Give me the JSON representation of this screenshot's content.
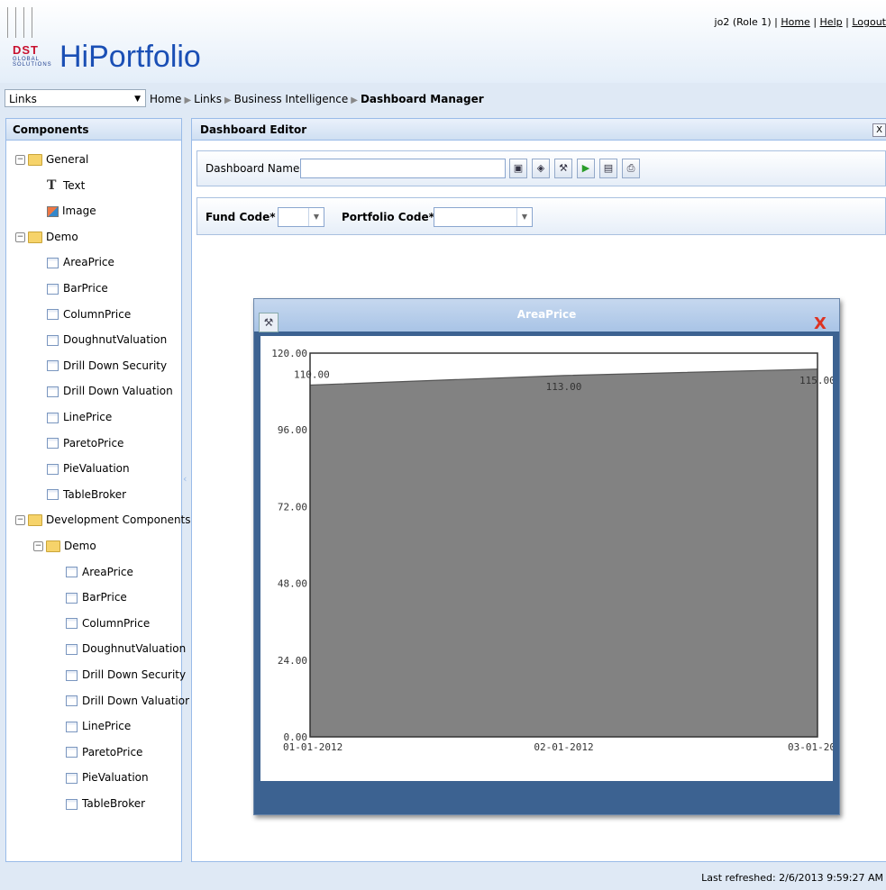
{
  "header": {
    "logo_text": "DST",
    "logo_subtext": "GLOBAL SOLUTIONS",
    "brand": "HiPortfolio",
    "user": "jo2 (Role 1)",
    "home_link": "Home",
    "help_link": "Help",
    "logout_link": "Logout",
    "sep": "|"
  },
  "nav": {
    "links_select_value": "Links",
    "breadcrumb": [
      "Home",
      "Links",
      "Business Intelligence",
      "Dashboard Manager"
    ]
  },
  "components": {
    "title": "Components",
    "general": {
      "label": "General",
      "items": [
        "Text",
        "Image"
      ]
    },
    "demo": {
      "label": "Demo",
      "items": [
        "AreaPrice",
        "BarPrice",
        "ColumnPrice",
        "DoughnutValuation",
        "Drill Down Security",
        "Drill Down Valuation",
        "LinePrice",
        "ParetoPrice",
        "PieValuation",
        "TableBroker"
      ]
    },
    "dev": {
      "label": "Development Components",
      "demo_label": "Demo",
      "items": [
        "AreaPrice",
        "BarPrice",
        "ColumnPrice",
        "DoughnutValuation",
        "Drill Down Security",
        "Drill Down Valuatior",
        "LinePrice",
        "ParetoPrice",
        "PieValuation",
        "TableBroker"
      ]
    }
  },
  "editor": {
    "title": "Dashboard Editor",
    "close_label": "X",
    "dashboard_name_label": "Dashboard Name :",
    "dashboard_name_value": "",
    "fund_code_label": "Fund Code* :",
    "portfolio_code_label": "Portfolio Code* :",
    "toolbar_icons": [
      "save-icon",
      "properties-icon",
      "wrench-icon",
      "run-icon",
      "preview-icon",
      "print-icon"
    ]
  },
  "chart_window": {
    "title": "AreaPrice",
    "close_label": "X"
  },
  "chart_data": {
    "type": "area",
    "title": "",
    "x": [
      "01-01-2012",
      "02-01-2012",
      "03-01-20"
    ],
    "values": [
      110.0,
      113.0,
      115.0
    ],
    "data_labels": [
      "110.00",
      "113.00",
      "115.00"
    ],
    "yticks": [
      "0.00",
      "24.00",
      "48.00",
      "72.00",
      "96.00",
      "120.00"
    ],
    "ylim": [
      0,
      120
    ],
    "fill_color": "#828282",
    "grid": true
  },
  "footer": {
    "last_refreshed": "Last refreshed: 2/6/2013 9:59:27 AM"
  }
}
